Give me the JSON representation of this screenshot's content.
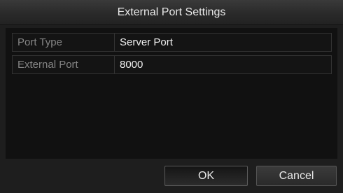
{
  "dialog": {
    "title": "External Port Settings"
  },
  "settings": {
    "rows": [
      {
        "label": "Port Type",
        "value": "Server Port"
      },
      {
        "label": "External Port",
        "value": "8000"
      }
    ]
  },
  "buttons": {
    "ok_label": "OK",
    "cancel_label": "Cancel"
  }
}
